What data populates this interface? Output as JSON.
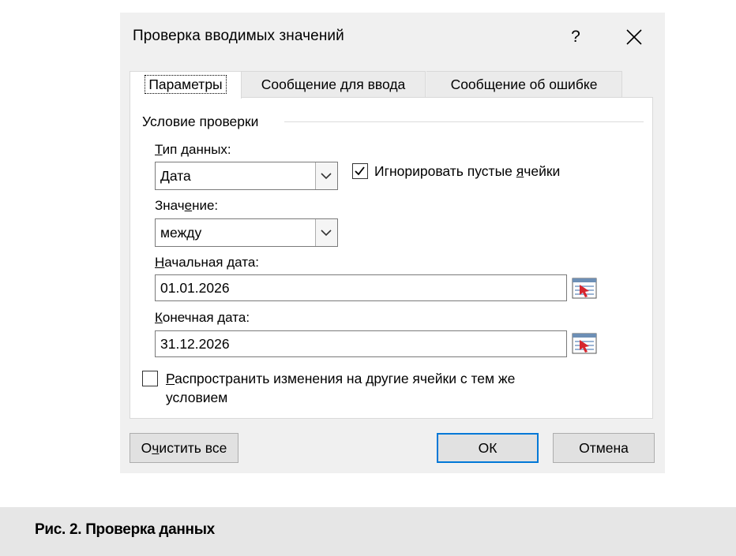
{
  "dialog": {
    "title": "Проверка вводимых значений",
    "help_label": "?",
    "tabs": [
      {
        "pre": "",
        "u": "",
        "post": "Параметры"
      },
      {
        "pre": "",
        "u": "",
        "post": "Сообщение для ввода"
      },
      {
        "pre": "",
        "u": "",
        "post": "Сообщение об ошибке"
      }
    ],
    "group_title": "Условие проверки",
    "data_type": {
      "label_pre": "",
      "label_u": "Т",
      "label_post": "ип данных:",
      "value": "Дата"
    },
    "ignore_blank": {
      "label_pre": "Игнорировать пустые ",
      "label_u": "я",
      "label_post": "чейки",
      "checked": true
    },
    "value_field": {
      "label_pre": "Знач",
      "label_u": "е",
      "label_post": "ние:",
      "value": "между"
    },
    "start_date": {
      "label_pre": "",
      "label_u": "Н",
      "label_post": "ачальная дата:",
      "value": "01.01.2026"
    },
    "end_date": {
      "label_pre": "",
      "label_u": "К",
      "label_post": "онечная дата:",
      "value": "31.12.2026"
    },
    "apply_all": {
      "line1_pre": "",
      "line1_u": "Р",
      "line1_post": "аспространить изменения на другие ячейки с тем же",
      "line2": "условием",
      "checked": false
    },
    "buttons": {
      "clear": {
        "pre": "О",
        "u": "ч",
        "post": "истить все"
      },
      "ok": "ОК",
      "cancel": "Отмена"
    }
  },
  "caption": "Рис. 2. Проверка данных",
  "colors": {
    "dialog_bg": "#f0f0f0",
    "default_button_border": "#0078d7",
    "caption_bg": "#e6e6e6"
  }
}
